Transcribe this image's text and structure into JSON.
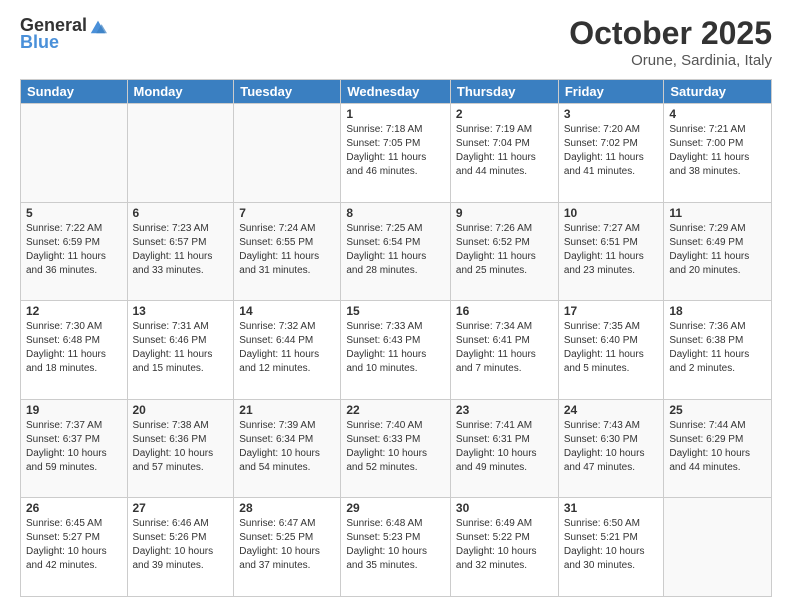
{
  "header": {
    "logo_general": "General",
    "logo_blue": "Blue",
    "title": "October 2025",
    "subtitle": "Orune, Sardinia, Italy"
  },
  "days_of_week": [
    "Sunday",
    "Monday",
    "Tuesday",
    "Wednesday",
    "Thursday",
    "Friday",
    "Saturday"
  ],
  "weeks": [
    [
      {
        "day": "",
        "info": ""
      },
      {
        "day": "",
        "info": ""
      },
      {
        "day": "",
        "info": ""
      },
      {
        "day": "1",
        "info": "Sunrise: 7:18 AM\nSunset: 7:05 PM\nDaylight: 11 hours and 46 minutes."
      },
      {
        "day": "2",
        "info": "Sunrise: 7:19 AM\nSunset: 7:04 PM\nDaylight: 11 hours and 44 minutes."
      },
      {
        "day": "3",
        "info": "Sunrise: 7:20 AM\nSunset: 7:02 PM\nDaylight: 11 hours and 41 minutes."
      },
      {
        "day": "4",
        "info": "Sunrise: 7:21 AM\nSunset: 7:00 PM\nDaylight: 11 hours and 38 minutes."
      }
    ],
    [
      {
        "day": "5",
        "info": "Sunrise: 7:22 AM\nSunset: 6:59 PM\nDaylight: 11 hours and 36 minutes."
      },
      {
        "day": "6",
        "info": "Sunrise: 7:23 AM\nSunset: 6:57 PM\nDaylight: 11 hours and 33 minutes."
      },
      {
        "day": "7",
        "info": "Sunrise: 7:24 AM\nSunset: 6:55 PM\nDaylight: 11 hours and 31 minutes."
      },
      {
        "day": "8",
        "info": "Sunrise: 7:25 AM\nSunset: 6:54 PM\nDaylight: 11 hours and 28 minutes."
      },
      {
        "day": "9",
        "info": "Sunrise: 7:26 AM\nSunset: 6:52 PM\nDaylight: 11 hours and 25 minutes."
      },
      {
        "day": "10",
        "info": "Sunrise: 7:27 AM\nSunset: 6:51 PM\nDaylight: 11 hours and 23 minutes."
      },
      {
        "day": "11",
        "info": "Sunrise: 7:29 AM\nSunset: 6:49 PM\nDaylight: 11 hours and 20 minutes."
      }
    ],
    [
      {
        "day": "12",
        "info": "Sunrise: 7:30 AM\nSunset: 6:48 PM\nDaylight: 11 hours and 18 minutes."
      },
      {
        "day": "13",
        "info": "Sunrise: 7:31 AM\nSunset: 6:46 PM\nDaylight: 11 hours and 15 minutes."
      },
      {
        "day": "14",
        "info": "Sunrise: 7:32 AM\nSunset: 6:44 PM\nDaylight: 11 hours and 12 minutes."
      },
      {
        "day": "15",
        "info": "Sunrise: 7:33 AM\nSunset: 6:43 PM\nDaylight: 11 hours and 10 minutes."
      },
      {
        "day": "16",
        "info": "Sunrise: 7:34 AM\nSunset: 6:41 PM\nDaylight: 11 hours and 7 minutes."
      },
      {
        "day": "17",
        "info": "Sunrise: 7:35 AM\nSunset: 6:40 PM\nDaylight: 11 hours and 5 minutes."
      },
      {
        "day": "18",
        "info": "Sunrise: 7:36 AM\nSunset: 6:38 PM\nDaylight: 11 hours and 2 minutes."
      }
    ],
    [
      {
        "day": "19",
        "info": "Sunrise: 7:37 AM\nSunset: 6:37 PM\nDaylight: 10 hours and 59 minutes."
      },
      {
        "day": "20",
        "info": "Sunrise: 7:38 AM\nSunset: 6:36 PM\nDaylight: 10 hours and 57 minutes."
      },
      {
        "day": "21",
        "info": "Sunrise: 7:39 AM\nSunset: 6:34 PM\nDaylight: 10 hours and 54 minutes."
      },
      {
        "day": "22",
        "info": "Sunrise: 7:40 AM\nSunset: 6:33 PM\nDaylight: 10 hours and 52 minutes."
      },
      {
        "day": "23",
        "info": "Sunrise: 7:41 AM\nSunset: 6:31 PM\nDaylight: 10 hours and 49 minutes."
      },
      {
        "day": "24",
        "info": "Sunrise: 7:43 AM\nSunset: 6:30 PM\nDaylight: 10 hours and 47 minutes."
      },
      {
        "day": "25",
        "info": "Sunrise: 7:44 AM\nSunset: 6:29 PM\nDaylight: 10 hours and 44 minutes."
      }
    ],
    [
      {
        "day": "26",
        "info": "Sunrise: 6:45 AM\nSunset: 5:27 PM\nDaylight: 10 hours and 42 minutes."
      },
      {
        "day": "27",
        "info": "Sunrise: 6:46 AM\nSunset: 5:26 PM\nDaylight: 10 hours and 39 minutes."
      },
      {
        "day": "28",
        "info": "Sunrise: 6:47 AM\nSunset: 5:25 PM\nDaylight: 10 hours and 37 minutes."
      },
      {
        "day": "29",
        "info": "Sunrise: 6:48 AM\nSunset: 5:23 PM\nDaylight: 10 hours and 35 minutes."
      },
      {
        "day": "30",
        "info": "Sunrise: 6:49 AM\nSunset: 5:22 PM\nDaylight: 10 hours and 32 minutes."
      },
      {
        "day": "31",
        "info": "Sunrise: 6:50 AM\nSunset: 5:21 PM\nDaylight: 10 hours and 30 minutes."
      },
      {
        "day": "",
        "info": ""
      }
    ]
  ]
}
